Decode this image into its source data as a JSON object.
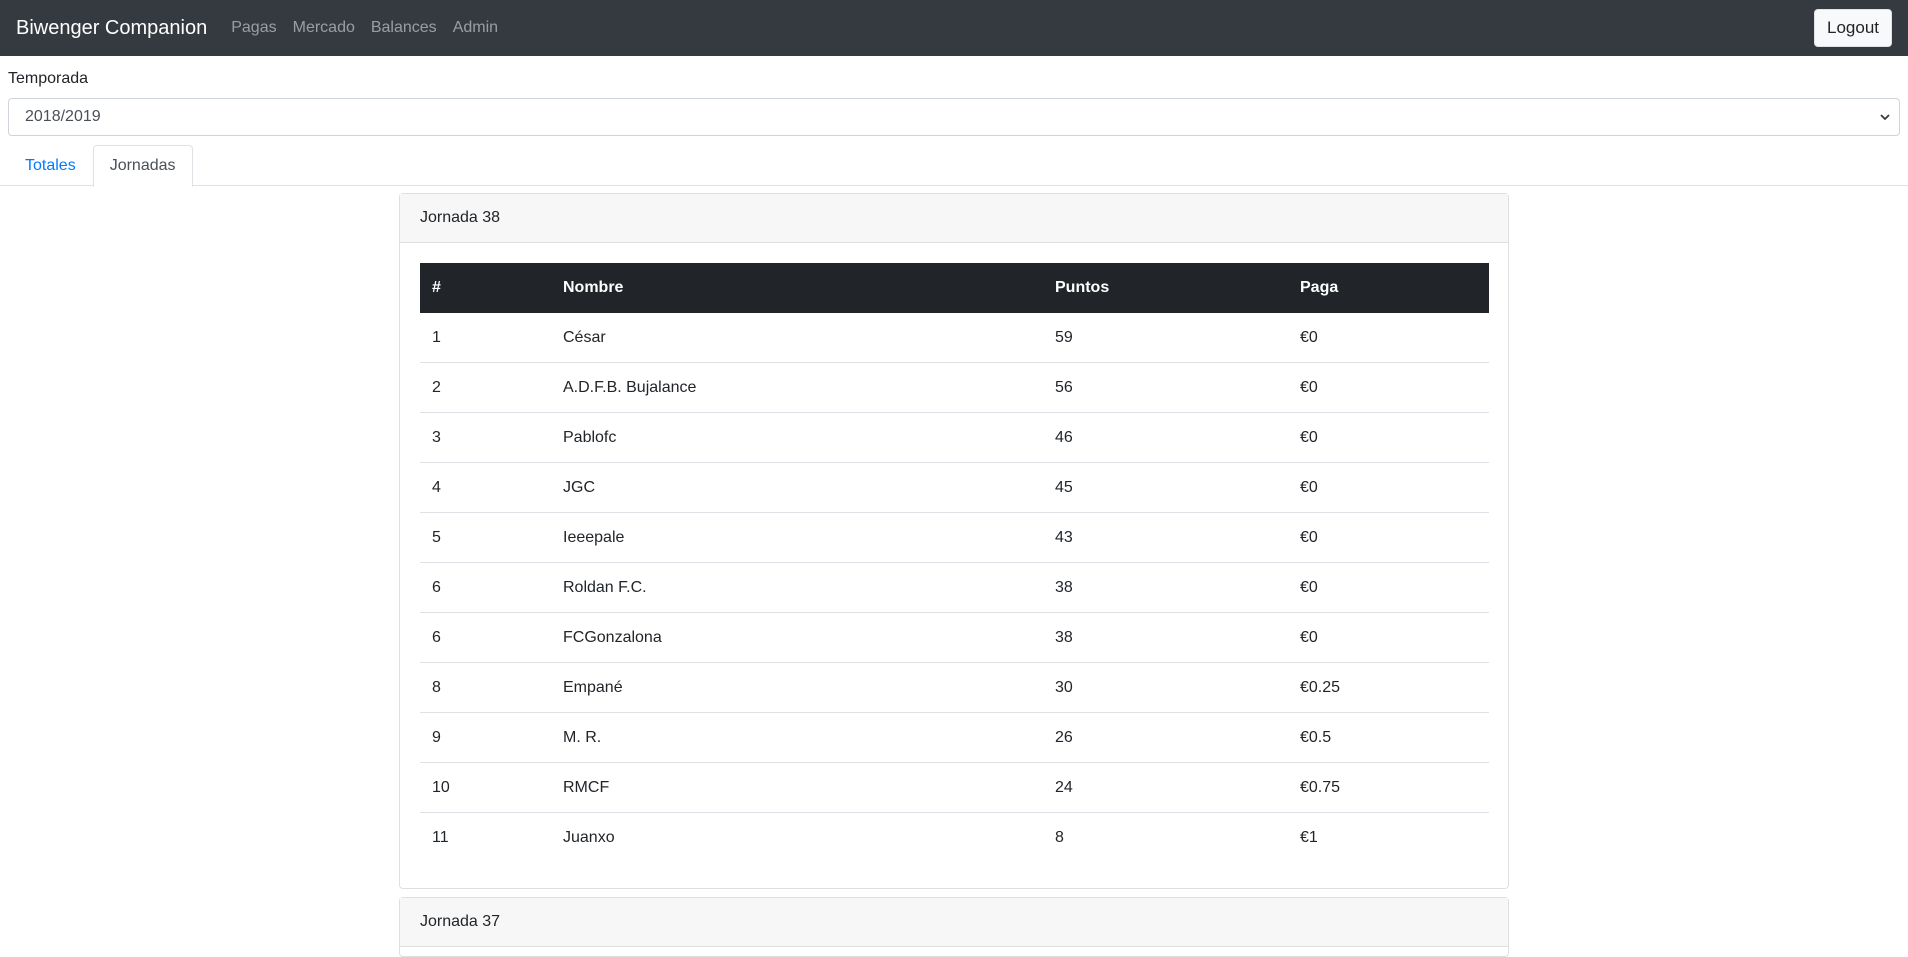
{
  "navbar": {
    "brand": "Biwenger Companion",
    "links": [
      "Pagas",
      "Mercado",
      "Balances",
      "Admin"
    ],
    "logout_label": "Logout"
  },
  "season": {
    "label": "Temporada",
    "selected": "2018/2019"
  },
  "tabs": [
    {
      "label": "Totales",
      "active": false
    },
    {
      "label": "Jornadas",
      "active": true
    }
  ],
  "jornadas": [
    {
      "title": "Jornada 38",
      "columns": [
        "#",
        "Nombre",
        "Puntos",
        "Paga"
      ],
      "rows": [
        [
          "1",
          "César",
          "59",
          "€0"
        ],
        [
          "2",
          "A.D.F.B. Bujalance",
          "56",
          "€0"
        ],
        [
          "3",
          "Pablofc",
          "46",
          "€0"
        ],
        [
          "4",
          "JGC",
          "45",
          "€0"
        ],
        [
          "5",
          "Ieeepale",
          "43",
          "€0"
        ],
        [
          "6",
          "Roldan F.C.",
          "38",
          "€0"
        ],
        [
          "6",
          "FCGonzalona",
          "38",
          "€0"
        ],
        [
          "8",
          "Empané",
          "30",
          "€0.25"
        ],
        [
          "9",
          "M. R.",
          "26",
          "€0.5"
        ],
        [
          "10",
          "RMCF",
          "24",
          "€0.75"
        ],
        [
          "11",
          "Juanxo",
          "8",
          "€1"
        ]
      ]
    },
    {
      "title": "Jornada 37"
    }
  ]
}
